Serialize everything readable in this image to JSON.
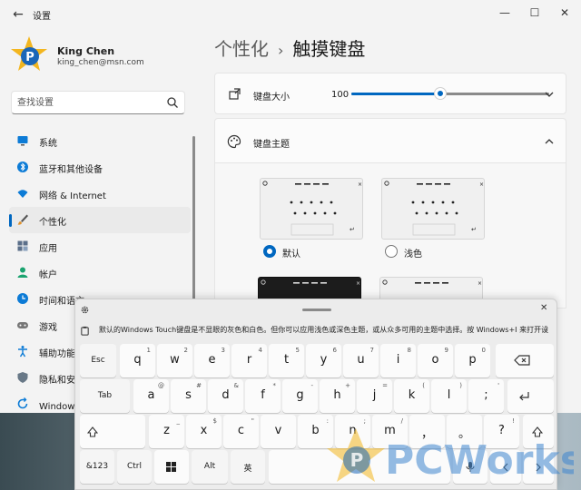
{
  "window": {
    "app_title": "设置"
  },
  "user": {
    "name": "King Chen",
    "email": "king_chen@msn.com"
  },
  "search": {
    "placeholder": "查找设置"
  },
  "nav": [
    {
      "label": "系统",
      "icon": "monitor-icon",
      "active": false
    },
    {
      "label": "蓝牙和其他设备",
      "icon": "bluetooth-icon",
      "active": false
    },
    {
      "label": "网络 & Internet",
      "icon": "wifi-icon",
      "active": false
    },
    {
      "label": "个性化",
      "icon": "brush-icon",
      "active": true
    },
    {
      "label": "应用",
      "icon": "apps-icon",
      "active": false
    },
    {
      "label": "帐户",
      "icon": "person-icon",
      "active": false
    },
    {
      "label": "时间和语言",
      "icon": "globe-clock-icon",
      "active": false
    },
    {
      "label": "游戏",
      "icon": "gamepad-icon",
      "active": false
    },
    {
      "label": "辅助功能",
      "icon": "accessibility-icon",
      "active": false
    },
    {
      "label": "隐私和安全性",
      "icon": "shield-icon",
      "active": false
    },
    {
      "label": "Windows 更新",
      "icon": "update-icon",
      "active": false
    }
  ],
  "breadcrumb": {
    "parent": "个性化",
    "sep": "›",
    "current": "触摸键盘"
  },
  "keyboard_size": {
    "label": "键盘大小",
    "value": "100",
    "level": 0.45
  },
  "keyboard_theme": {
    "label": "键盘主题"
  },
  "themes": [
    {
      "label": "默认",
      "selected": true
    },
    {
      "label": "浅色",
      "selected": false
    }
  ],
  "touch_keyboard": {
    "suggestion": "默认的Windows Touch键盘是不显眼的灰色和白色。但你可以应用浅色或深色主题，或从众多可用的主题中选择。按 Windows+I 来打开设置。",
    "close": "✕",
    "rows": [
      [
        {
          "m": "Esc",
          "fn": true
        },
        {
          "m": "q",
          "s": "1"
        },
        {
          "m": "w",
          "s": "2"
        },
        {
          "m": "e",
          "s": "3"
        },
        {
          "m": "r",
          "s": "4"
        },
        {
          "m": "t",
          "s": "5"
        },
        {
          "m": "y",
          "s": "6"
        },
        {
          "m": "u",
          "s": "7"
        },
        {
          "m": "i",
          "s": "8"
        },
        {
          "m": "o",
          "s": "9"
        },
        {
          "m": "p",
          "s": "0"
        }
      ],
      [
        {
          "m": "Tab",
          "fn": true
        },
        {
          "m": "a",
          "s": "@"
        },
        {
          "m": "s",
          "s": "#"
        },
        {
          "m": "d",
          "s": "&"
        },
        {
          "m": "f",
          "s": "*"
        },
        {
          "m": "g",
          "s": "-"
        },
        {
          "m": "h",
          "s": "+"
        },
        {
          "m": "j",
          "s": "="
        },
        {
          "m": "k",
          "s": "("
        },
        {
          "m": "l",
          "s": ")"
        },
        {
          "m": ";",
          "s": "'"
        }
      ],
      [
        {
          "m": "z",
          "s": "_"
        },
        {
          "m": "x",
          "s": "$"
        },
        {
          "m": "c",
          "s": "\""
        },
        {
          "m": "v",
          "s": ""
        },
        {
          "m": "b",
          "s": ":"
        },
        {
          "m": "n",
          "s": ";"
        },
        {
          "m": "m",
          "s": "/"
        },
        {
          "m": "，",
          "s": ""
        },
        {
          "m": "。",
          "s": ""
        },
        {
          "m": "?",
          "s": "!"
        }
      ],
      [
        {
          "m": "&123",
          "fn": true
        },
        {
          "m": "Ctrl",
          "fn": true
        },
        {
          "m": "Alt",
          "fn": true
        },
        {
          "m": "英",
          "fn": true
        }
      ]
    ]
  },
  "watermark": {
    "text": "PCWorks"
  },
  "colors": {
    "accent": "#0067c0"
  }
}
